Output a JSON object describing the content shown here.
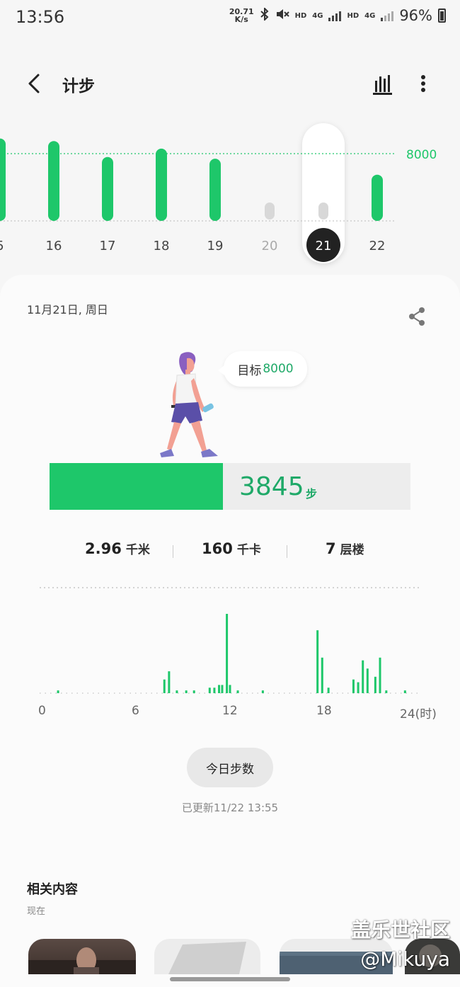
{
  "status_bar": {
    "time": "13:56",
    "net_speed_value": "20.71",
    "net_speed_unit": "K/s",
    "hd1": "HD",
    "net1": "4G",
    "hd2": "HD",
    "net2": "4G",
    "battery": "96%",
    "icons": [
      "bluetooth-icon",
      "mute-icon",
      "signal-icon",
      "battery-icon"
    ]
  },
  "header": {
    "title": "计步",
    "back_icon": "chevron-left-icon",
    "chart_icon": "bar-chart-icon",
    "more_icon": "more-vertical-icon"
  },
  "week_chart": {
    "goal": 8000,
    "goal_label": "8000",
    "days": [
      {
        "label": "5",
        "steps": 9800,
        "status": "normal"
      },
      {
        "label": "16",
        "steps": 9500,
        "status": "normal"
      },
      {
        "label": "17",
        "steps": 7600,
        "status": "normal"
      },
      {
        "label": "18",
        "steps": 8600,
        "status": "normal"
      },
      {
        "label": "19",
        "steps": 7400,
        "status": "normal"
      },
      {
        "label": "20",
        "steps": 0,
        "status": "empty"
      },
      {
        "label": "21",
        "steps": 3845,
        "status": "selected"
      },
      {
        "label": "22",
        "steps": 5500,
        "status": "normal"
      }
    ],
    "colors": {
      "bar": "#1ec76a",
      "empty": "#d8d8d8",
      "goal_line": "#1ec76a",
      "selected_badge": "#222222"
    }
  },
  "summary": {
    "date": "11月21日, 周日",
    "share_icon": "share-icon",
    "goal_prefix": "目标",
    "goal_value": "8000",
    "steps": "3845",
    "steps_unit": "步",
    "progress_fraction": 0.481
  },
  "stats": {
    "distance_value": "2.96",
    "distance_unit": "千米",
    "calories_value": "160",
    "calories_unit": "千卡",
    "floors_value": "7",
    "floors_unit": "层楼"
  },
  "chart_data": {
    "type": "bar",
    "x_unit": "hour",
    "x_ticks": [
      "0",
      "6",
      "12",
      "18",
      "24(时)"
    ],
    "xlim": [
      0,
      24
    ],
    "values": [
      [
        1.0,
        1
      ],
      [
        7.8,
        5
      ],
      [
        8.1,
        8
      ],
      [
        8.6,
        1
      ],
      [
        9.2,
        1
      ],
      [
        9.7,
        1
      ],
      [
        10.7,
        2
      ],
      [
        11.0,
        2
      ],
      [
        11.3,
        3
      ],
      [
        11.5,
        3
      ],
      [
        11.8,
        29
      ],
      [
        12.0,
        3
      ],
      [
        12.5,
        1
      ],
      [
        14.1,
        1
      ],
      [
        17.6,
        23
      ],
      [
        17.9,
        13
      ],
      [
        18.3,
        2
      ],
      [
        19.9,
        5
      ],
      [
        20.2,
        4
      ],
      [
        20.5,
        12
      ],
      [
        20.8,
        9
      ],
      [
        21.3,
        6
      ],
      [
        21.6,
        13
      ],
      [
        22.0,
        1
      ],
      [
        23.2,
        1
      ]
    ],
    "baseline_dots": true,
    "color": "#1ec76a"
  },
  "today_button": "今日步数",
  "updated": "已更新11/22 13:55",
  "related": {
    "title": "相关内容",
    "subtitle": "现在"
  },
  "watermark": {
    "line1": "盖乐世社区",
    "line2": "@Mikuya"
  }
}
